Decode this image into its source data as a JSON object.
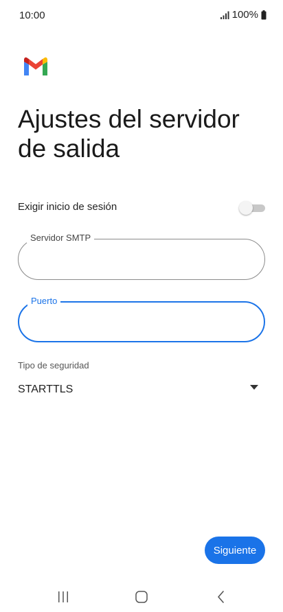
{
  "status_bar": {
    "time": "10:00",
    "battery": "100%",
    "icons": [
      "signal-icon",
      "battery-icon"
    ]
  },
  "app": {
    "logo": "gmail-logo",
    "brand_colors": {
      "blue": "#4285F4",
      "red": "#EA4335",
      "yellow": "#FBBC04",
      "green": "#34A853",
      "dark_red": "#C5221F"
    }
  },
  "page": {
    "title": "Ajustes del servidor de salida"
  },
  "require_signin": {
    "label": "Exigir inicio de sesión",
    "enabled": false
  },
  "fields": {
    "smtp": {
      "label": "Servidor SMTP",
      "value": ""
    },
    "port": {
      "label": "Puerto",
      "value": "",
      "focused": true
    }
  },
  "security": {
    "label": "Tipo de seguridad",
    "value": "STARTTLS"
  },
  "actions": {
    "next_label": "Siguiente"
  },
  "colors": {
    "accent": "#1a73e8",
    "outline": "#8a8a8a",
    "toggle_off": "#c8c8c8"
  },
  "nav_bar": {
    "items": [
      "recents-icon",
      "home-icon",
      "back-icon"
    ]
  }
}
